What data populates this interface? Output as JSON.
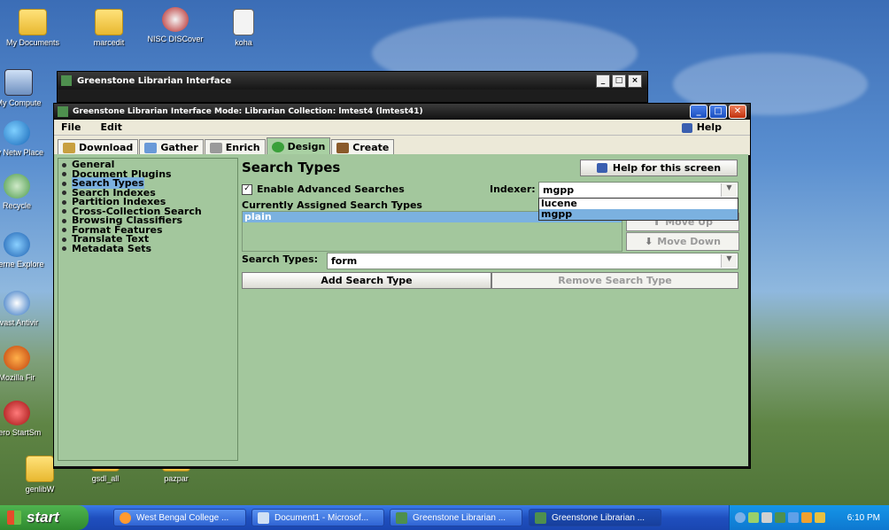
{
  "desktop": {
    "icons": [
      {
        "label": "My Documents"
      },
      {
        "label": "marcedit"
      },
      {
        "label": "NISC DISCover"
      },
      {
        "label": "koha"
      },
      {
        "label": "My Compute"
      },
      {
        "label": "My Netw Place"
      },
      {
        "label": "Recycle"
      },
      {
        "label": "Interne Explore"
      },
      {
        "label": "avast Antivir"
      },
      {
        "label": "Mozilla Fir"
      },
      {
        "label": "Nero StartSm"
      },
      {
        "label": "genlibW"
      },
      {
        "label": "gsdl_all"
      },
      {
        "label": "pazpar"
      }
    ]
  },
  "back_window": {
    "title": "Greenstone Librarian Interface",
    "controls": [
      "_",
      "□",
      "×"
    ]
  },
  "window": {
    "title": "Greenstone Librarian Interface  Mode: Librarian  Collection: lmtest4 (lmtest41)",
    "menu": {
      "file": "File",
      "edit": "Edit",
      "help": "Help"
    },
    "tabs": [
      "Download",
      "Gather",
      "Enrich",
      "Design",
      "Create"
    ],
    "active_tab": "Design",
    "sidebar": {
      "items": [
        "General",
        "Document Plugins",
        "Search Types",
        "Search Indexes",
        "Partition Indexes",
        "Cross-Collection Search",
        "Browsing Classifiers",
        "Format Features",
        "Translate Text",
        "Metadata Sets"
      ],
      "selected": "Search Types"
    },
    "panel": {
      "title": "Search Types",
      "help_button": "Help for this screen",
      "enable_advanced_label": "Enable Advanced Searches",
      "enable_advanced_checked": true,
      "indexer_label": "Indexer:",
      "indexer_value": "mgpp",
      "indexer_options": [
        "lucene",
        "mgpp"
      ],
      "indexer_highlighted": "mgpp",
      "assigned_label": "Currently Assigned Search Types",
      "assigned_items": [
        "plain"
      ],
      "move_up": "Move Up",
      "move_down": "Move Down",
      "search_types_label": "Search Types:",
      "search_types_value": "form",
      "add_button": "Add Search Type",
      "remove_button": "Remove Search Type"
    }
  },
  "taskbar": {
    "start": "start",
    "items": [
      {
        "label": "West Bengal College ..."
      },
      {
        "label": "Document1 - Microsof..."
      },
      {
        "label": "Greenstone Librarian ..."
      },
      {
        "label": "Greenstone Librarian ..."
      }
    ],
    "clock": "6:10 PM"
  },
  "colors": {
    "panel_bg": "#a3c79d",
    "selection": "#7bb1e0",
    "taskbar": "#245edb"
  }
}
